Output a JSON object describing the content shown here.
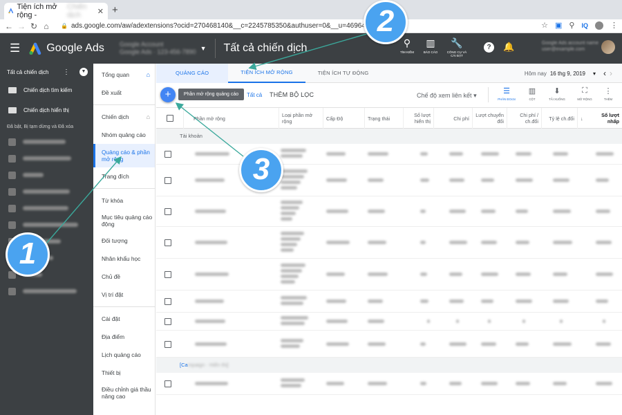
{
  "browser": {
    "tab_title": "Tiện ích mở rộng -",
    "tab_title_blurred": "Chiến dịch",
    "url": "ads.google.com/aw/adextensions?ocid=270468140&__c=2245785350&authuser=0&__u=4696439568"
  },
  "header": {
    "app_name": "Google Ads",
    "account_blurred_1": "Google Account",
    "account_blurred_2": "Google Ads · 123-456-7890",
    "page_title": "Tất cả chiến dịch",
    "icons": [
      {
        "icon": "search-icon",
        "label": "TÌM KIẾM"
      },
      {
        "icon": "reports-icon",
        "label": "BÁO CÁO"
      },
      {
        "icon": "wrench-icon",
        "label": "CÔNG CỤ VÀ CÀI ĐẶT"
      }
    ],
    "user_blurred_1": "Google Ads account name",
    "user_blurred_2": "user@example.com"
  },
  "leftnav": {
    "all_campaigns": "Tất cả chiến dịch",
    "items": [
      {
        "label": "Chiến dịch tìm kiếm",
        "icon": "search-campaign-icon"
      },
      {
        "label": "Chiến dịch hiển thị",
        "icon": "display-campaign-icon"
      }
    ],
    "section": "Đã bật, Bị tạm dừng và Đã xóa"
  },
  "pagemenu": {
    "items": [
      {
        "label": "Tổng quan"
      },
      {
        "label": "Đề xuất"
      },
      {
        "label": "Chiến dịch"
      },
      {
        "label": "Nhóm quảng cáo"
      },
      {
        "label": "Quảng cáo & phần mở rộng"
      },
      {
        "label": "Trang đích"
      },
      {
        "label": "Từ khóa"
      },
      {
        "label": "Mục tiêu quảng cáo động"
      },
      {
        "label": "Đối tượng"
      },
      {
        "label": "Nhân khẩu học"
      },
      {
        "label": "Chủ đề"
      },
      {
        "label": "Vị trí đặt"
      },
      {
        "label": "Cài đặt"
      },
      {
        "label": "Địa điểm"
      },
      {
        "label": "Lịch quảng cáo"
      },
      {
        "label": "Thiết bị"
      },
      {
        "label": "Điều chỉnh giá thầu nâng cao"
      }
    ]
  },
  "tabs": [
    "QUẢNG CÁO",
    "TIỆN ÍCH MỞ RỘNG",
    "TIỆN ÍCH TỰ ĐỘNG"
  ],
  "date": {
    "label": "Hôm nay",
    "value": "16 thg 9, 2019"
  },
  "toolbar": {
    "tooltip": "Phần mở rộng quảng cáo",
    "filter_all": "Tất cả",
    "add_filter": "THÊM BỘ LỌC",
    "view_mode": "Chế độ xem liên kết",
    "buttons": [
      {
        "icon": "segment-icon",
        "label": "PHÂN ĐOẠN"
      },
      {
        "icon": "columns-icon",
        "label": "CỘT"
      },
      {
        "icon": "download-icon",
        "label": "TẢI XUỐNG"
      },
      {
        "icon": "expand-icon",
        "label": "MỞ RỘNG"
      },
      {
        "icon": "more-icon",
        "label": "THÊM"
      }
    ]
  },
  "table": {
    "columns": [
      "Phần mở rộng",
      "Loại phần mở rộng",
      "Cấp Độ",
      "Trạng thái",
      "Số lượt hiển thị",
      "Chi phí",
      "Lượt chuyển đổi",
      "Chi phí / ch.đổi",
      "Tỷ lệ ch.đổi",
      "Số lượt nhấp"
    ],
    "group": "Tài khoản",
    "group2_prefix": "[Ca",
    "group2_blurred": "mpaign · Hiển thị]"
  },
  "annotations": [
    "1",
    "2",
    "3"
  ]
}
